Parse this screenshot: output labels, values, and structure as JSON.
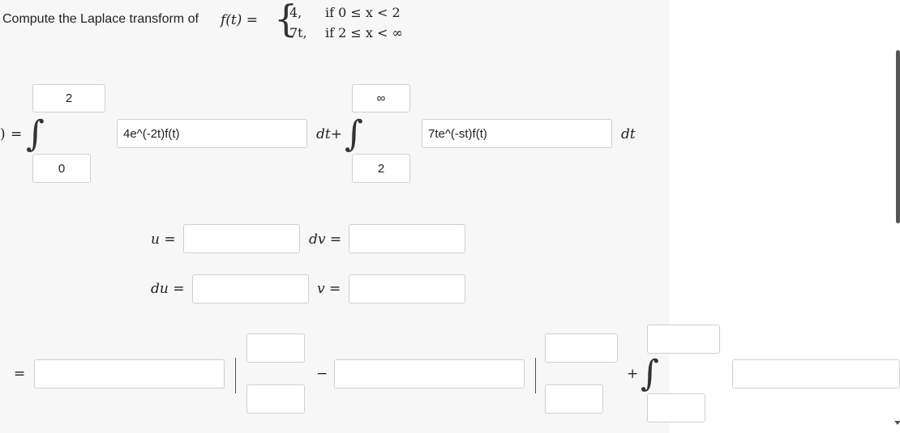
{
  "problem": {
    "prompt": "Compute the Laplace transform of",
    "f_lhs": "f(t) =",
    "piece1_value": "4,",
    "piece1_cond": "if 0 ≤ x < 2",
    "piece2_value": "7t,",
    "piece2_cond": "if 2 ≤ x < ∞"
  },
  "row1": {
    "left_paren": ")",
    "equals": "=",
    "int1_upper": "2",
    "int1_lower": "0",
    "integrand1": "4e^(-2t)f(t)",
    "dt_plus": "dt+",
    "int2_upper": "∞",
    "int2_lower": "2",
    "integrand2": "7te^(-st)f(t)",
    "dt": "dt"
  },
  "parts": {
    "u_label": "u =",
    "dv_label": "dv =",
    "du_label": "du =",
    "v_label": "v =",
    "u_value": "",
    "dv_value": "",
    "du_value": "",
    "v_value": ""
  },
  "row3": {
    "equals": "=",
    "minus": "−",
    "plus": "+",
    "answer1": "",
    "eval1_upper": "",
    "eval1_lower": "",
    "answer2": "",
    "eval2_upper": "",
    "eval2_lower": "",
    "int3_upper": "",
    "int3_lower": "",
    "answer3": ""
  }
}
